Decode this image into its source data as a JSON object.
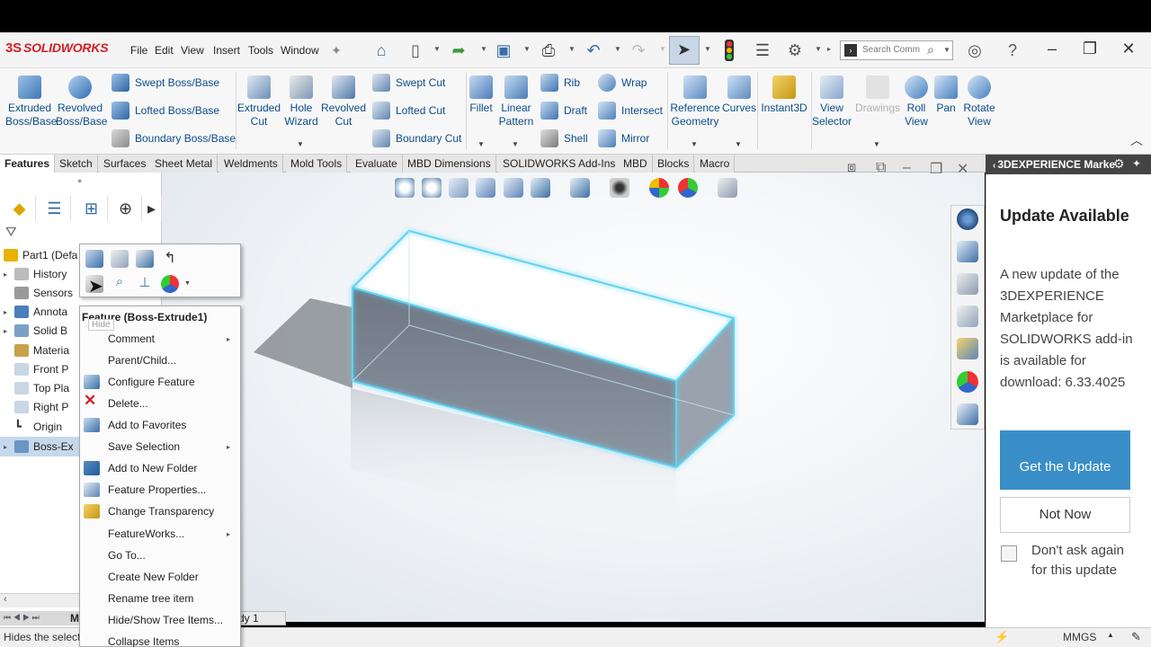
{
  "app": {
    "name": "SOLIDWORKS",
    "logo_prefix": "3S"
  },
  "menu": [
    "File",
    "Edit",
    "View",
    "Insert",
    "Tools",
    "Window"
  ],
  "search": {
    "placeholder": "Search Comm"
  },
  "features_left": {
    "extruded_boss": "Extruded\nBoss/Base",
    "revolved_boss": "Revolved\nBoss/Base",
    "swept_boss": "Swept Boss/Base",
    "lofted_boss": "Lofted Boss/Base",
    "boundary_boss": "Boundary Boss/Base",
    "extruded_cut": "Extruded\nCut",
    "hole_wizard": "Hole\nWizard",
    "revolved_cut": "Revolved\nCut",
    "swept_cut": "Swept Cut",
    "lofted_cut": "Lofted Cut",
    "boundary_cut": "Boundary Cut",
    "fillet": "Fillet",
    "linear_pattern": "Linear\nPattern",
    "rib": "Rib",
    "draft": "Draft",
    "shell": "Shell",
    "wrap": "Wrap",
    "intersect": "Intersect",
    "mirror": "Mirror",
    "reference_geometry": "Reference\nGeometry",
    "curves": "Curves",
    "instant3d": "Instant3D",
    "view_selector": "View\nSelector",
    "drawings": "Drawings",
    "roll_view": "Roll\nView",
    "pan": "Pan",
    "rotate_view": "Rotate\nView"
  },
  "tabs": [
    "Features",
    "Sketch",
    "Surfaces",
    "Sheet Metal",
    "Weldments",
    "Mold Tools",
    "Evaluate",
    "MBD Dimensions",
    "SOLIDWORKS Add-Ins",
    "MBD",
    "Blocks",
    "Macro"
  ],
  "tree": {
    "part": "Part1  (Defa",
    "history": "History",
    "sensors": "Sensors",
    "annotations": "Annota",
    "solid_bodies": "Solid B",
    "material": "Materia",
    "front_plane": "Front P",
    "top_plane": "Top Pla",
    "right_plane": "Right P",
    "origin": "Origin",
    "boss_extrude": "Boss-Ex"
  },
  "context_menu": {
    "title": "Feature (Boss-Extrude1)",
    "hide_tip": "Hide",
    "items": [
      "Comment",
      "Parent/Child...",
      "Configure Feature",
      "Delete...",
      "Add to Favorites",
      "Save Selection",
      "Add to New Folder",
      "Feature Properties...",
      "Change Transparency",
      "FeatureWorks...",
      "Go To...",
      "Create New Folder",
      "Rename tree item",
      "Hide/Show Tree Items...",
      "Collapse Items"
    ]
  },
  "model_tab": "dy 1",
  "bottom_tab_letter": "M",
  "status": {
    "left": "Hides the selecte",
    "units": "MMGS"
  },
  "right_panel": {
    "header": "3DEXPERIENCE Marke",
    "update_title": "Update Available",
    "update_body": "A new update of the 3DEXPERIENCE Marketplace for SOLIDWORKS add-in is available for download: 6.33.4025",
    "get_update": "Get the Update",
    "not_now": "Not Now",
    "dont_ask": "Don't ask again for this update"
  },
  "colors": {
    "accent": "#3a8ec7",
    "brand": "#d21f26",
    "link": "#0c4c8a"
  }
}
